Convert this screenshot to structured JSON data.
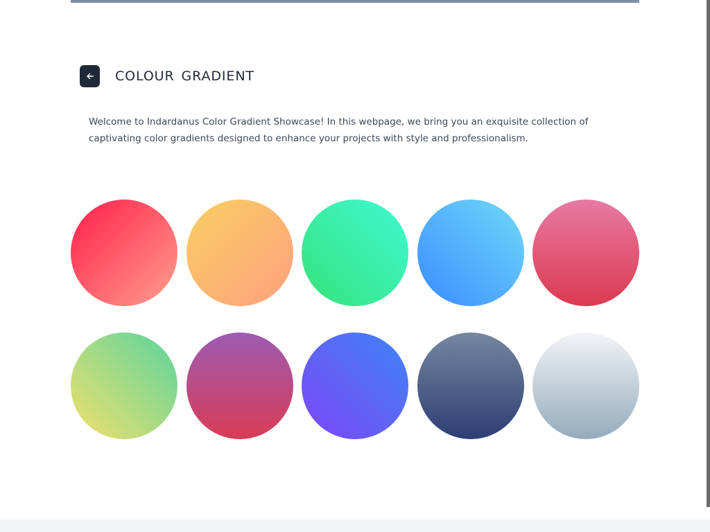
{
  "header": {
    "back_icon": "arrow-left-icon",
    "title": "COLOUR GRADIENT"
  },
  "description": "Welcome to Indardanus Color Gradient Showcase! In this webpage, we bring you an exquisite collection of captivating color gradients designed to enhance your projects with style and professionalism.",
  "colors": {
    "top_bar": "#7f8ea3",
    "back_button": "#1f2937",
    "title_text": "#1f2937",
    "body_text": "#3d4756",
    "footer_strip": "#f1f4f5"
  },
  "gradients": [
    {
      "direction": "to bottom right",
      "from": "#ff1f4b",
      "to": "#ff9f8e"
    },
    {
      "direction": "to bottom right",
      "from": "#f8cf62",
      "to": "#ffa07e"
    },
    {
      "direction": "to top right",
      "from": "#36e27a",
      "to": "#3ffad2"
    },
    {
      "direction": "to top right",
      "from": "#3b8cff",
      "to": "#6fdaf9"
    },
    {
      "direction": "to bottom",
      "from": "#e77aa3",
      "to": "#db3a4f"
    },
    {
      "direction": "to top right",
      "from": "#f2e06a",
      "to": "#5ad4a0"
    },
    {
      "direction": "to top",
      "from": "#d83c55",
      "to": "#9e5bb3"
    },
    {
      "direction": "to top right",
      "from": "#7e46f6",
      "to": "#3d84f7"
    },
    {
      "direction": "to top",
      "from": "#2d3e74",
      "to": "#7687a0"
    },
    {
      "direction": "to bottom",
      "from": "#f3f4f7",
      "to": "#94abbc"
    }
  ]
}
